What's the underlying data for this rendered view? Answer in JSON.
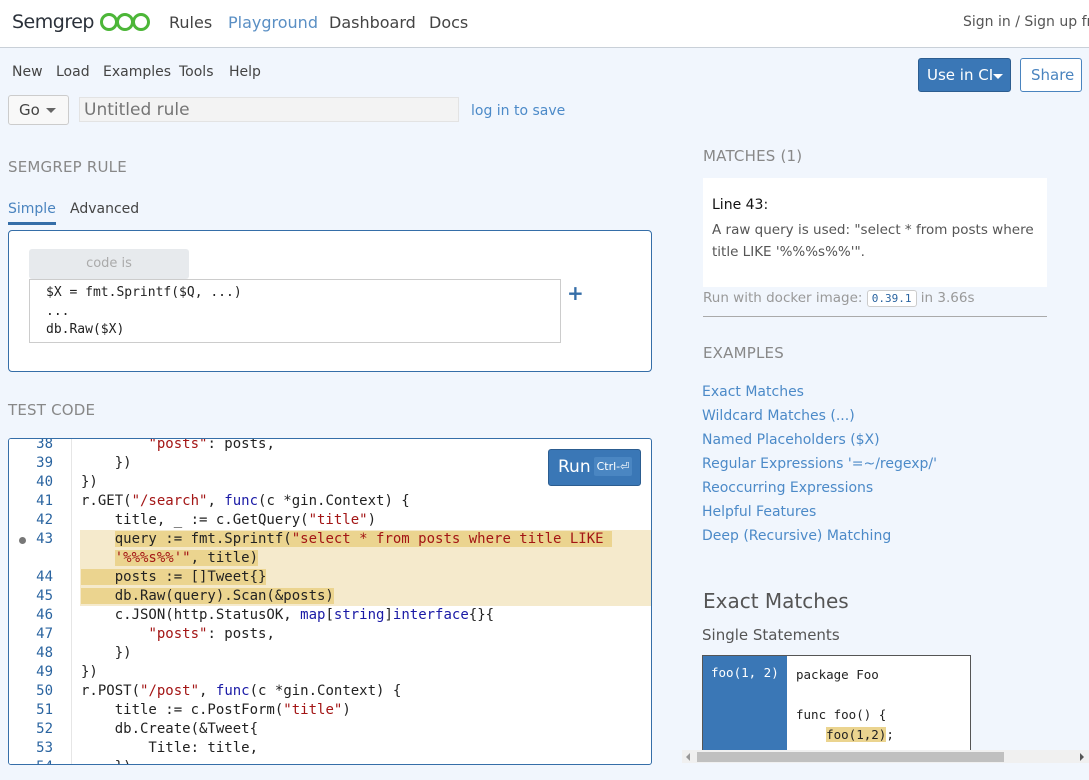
{
  "nav": {
    "brand": "Semgrep",
    "links": [
      "Rules",
      "Playground",
      "Dashboard",
      "Docs"
    ],
    "active": "Playground",
    "signin": "Sign in / Sign up free",
    "brand_color": "#4cb638"
  },
  "menu": [
    "New",
    "Load",
    "Examples",
    "Tools",
    "Help"
  ],
  "language": "Go",
  "rule_title_placeholder": "Untitled rule",
  "login_link": "log in to save",
  "use_in_ci": "Use in CI",
  "share": "Share",
  "rule": {
    "heading": "SEMGREP RULE",
    "tabs": [
      "Simple",
      "Advanced"
    ],
    "active_tab": "Simple",
    "operator": "code is",
    "pattern": "$X = fmt.Sprintf($Q, ...)\n...\ndb.Raw($X)",
    "add": "+"
  },
  "test": {
    "heading": "TEST CODE",
    "run": "Run",
    "run_shortcut": "Ctrl-⏎",
    "lines": [
      {
        "n": "38",
        "seg": [
          [
            "        ",
            ""
          ],
          [
            "\"posts\"",
            "str"
          ],
          [
            ": posts,",
            ""
          ]
        ]
      },
      {
        "n": "39",
        "seg": [
          [
            "    })",
            ""
          ]
        ]
      },
      {
        "n": "40",
        "seg": [
          [
            "})",
            ""
          ]
        ]
      },
      {
        "n": "41",
        "seg": [
          [
            "r.GET(",
            ""
          ],
          [
            "\"/search\"",
            "str"
          ],
          [
            ", ",
            ""
          ],
          [
            "func",
            "kw"
          ],
          [
            "(c *gin.Context) {",
            ""
          ]
        ]
      },
      {
        "n": "42",
        "seg": [
          [
            "    title, _ := c.GetQuery(",
            ""
          ],
          [
            "\"title\"",
            "str"
          ],
          [
            ")",
            ""
          ]
        ]
      },
      {
        "n": "43",
        "hl": true,
        "seg": [
          [
            "    ",
            ""
          ],
          [
            "query := fmt.Sprintf(",
            "m"
          ],
          [
            "\"select * from posts where title LIKE ",
            "ms"
          ]
        ]
      },
      {
        "n": "",
        "hl": true,
        "seg": [
          [
            "    ",
            ""
          ],
          [
            "'%%%s%%'\"",
            "ms"
          ],
          [
            ", title)",
            "m"
          ]
        ]
      },
      {
        "n": "44",
        "hl": true,
        "seg": [
          [
            "    posts := []Tweet{}",
            "m"
          ]
        ]
      },
      {
        "n": "45",
        "hl": true,
        "seg": [
          [
            "    db.Raw(query).Scan(&posts)",
            "m"
          ]
        ]
      },
      {
        "n": "46",
        "seg": [
          [
            "    c.JSON(http.StatusOK, ",
            ""
          ],
          [
            "map",
            "kw"
          ],
          [
            "[",
            ""
          ],
          [
            "string",
            "kw"
          ],
          [
            "]",
            ""
          ],
          [
            "interface",
            "kw"
          ],
          [
            "{}{",
            ""
          ]
        ]
      },
      {
        "n": "47",
        "seg": [
          [
            "        ",
            ""
          ],
          [
            "\"posts\"",
            "str"
          ],
          [
            ": posts,",
            ""
          ]
        ]
      },
      {
        "n": "48",
        "seg": [
          [
            "    })",
            ""
          ]
        ]
      },
      {
        "n": "49",
        "seg": [
          [
            "})",
            ""
          ]
        ]
      },
      {
        "n": "50",
        "seg": [
          [
            "r.POST(",
            ""
          ],
          [
            "\"/post\"",
            "str"
          ],
          [
            ", ",
            ""
          ],
          [
            "func",
            "kw"
          ],
          [
            "(c *gin.Context) {",
            ""
          ]
        ]
      },
      {
        "n": "51",
        "seg": [
          [
            "    title := c.PostForm(",
            ""
          ],
          [
            "\"title\"",
            "str"
          ],
          [
            ")",
            ""
          ]
        ]
      },
      {
        "n": "52",
        "seg": [
          [
            "    db.Create(&Tweet{",
            ""
          ]
        ]
      },
      {
        "n": "53",
        "seg": [
          [
            "        Title: title,",
            ""
          ]
        ]
      },
      {
        "n": "54",
        "seg": [
          [
            "    })",
            ""
          ]
        ]
      }
    ]
  },
  "matches": {
    "heading": "MATCHES (1)",
    "line": "Line 43:",
    "message": "A raw query is used: \"select * from posts where title LIKE '%%%s%%'\".",
    "run_prefix": "Run with docker image:",
    "image": "0.39.1",
    "run_suffix": "in 3.66s"
  },
  "examples": {
    "heading": "EXAMPLES",
    "items": [
      "Exact Matches",
      "Wildcard Matches (...)",
      "Named Placeholders ($X)",
      "Regular Expressions '=~/regexp/'",
      "Reoccurring Expressions",
      "Helpful Features",
      "Deep (Recursive) Matching"
    ]
  },
  "exact": {
    "heading": "Exact Matches",
    "sub": "Single Statements",
    "pattern": "foo(1, 2)",
    "code_lines": [
      "package Foo",
      "",
      "func foo() {"
    ],
    "code_match_indent": "    ",
    "code_match": "foo(1,2)",
    "code_match_tail": ";"
  }
}
